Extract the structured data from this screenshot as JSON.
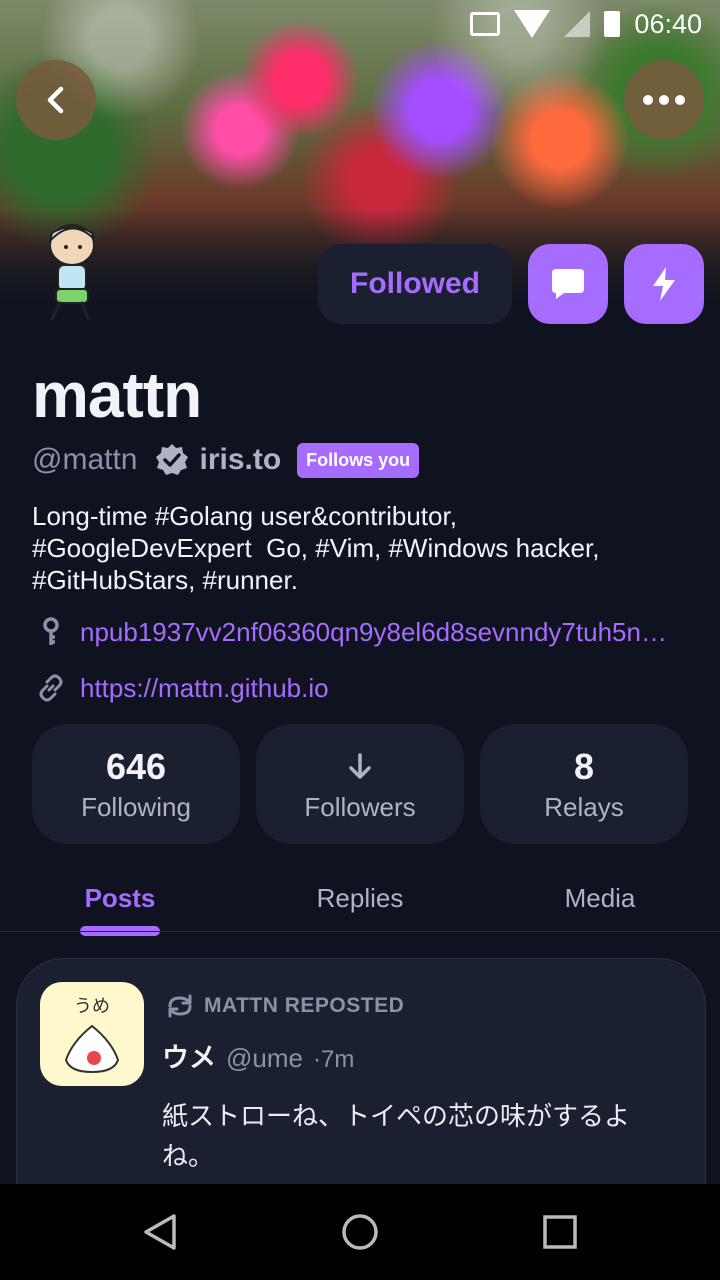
{
  "status_bar": {
    "time": "06:40"
  },
  "profile": {
    "display_name": "mattn",
    "handle": "@mattn",
    "nip05": "iris.to",
    "follows_you_badge": "Follows you",
    "bio_lines": [
      "Long-time #Golang user&contributor,",
      "#GoogleDevExpert  Go, #Vim, #Windows hacker,",
      "#GitHubStars, #runner."
    ],
    "npub": "npub1937vv2nf06360qn9y8el6d8sevnndy7tuh5n…",
    "website": "https://mattn.github.io"
  },
  "actions": {
    "follow_label": "Followed"
  },
  "stats": {
    "following": {
      "value": "646",
      "label": "Following"
    },
    "followers": {
      "label": "Followers"
    },
    "relays": {
      "value": "8",
      "label": "Relays"
    }
  },
  "tabs": [
    {
      "label": "Posts",
      "active": true
    },
    {
      "label": "Replies",
      "active": false
    },
    {
      "label": "Media",
      "active": false
    }
  ],
  "post": {
    "repost_label": "MATTN REPOSTED",
    "author": "ウメ",
    "handle": "@ume",
    "time": "·7m",
    "text": "紙ストローね、トイペの芯の味がするよね。",
    "avatar_text": "うめ"
  },
  "colors": {
    "accent": "#a66bff",
    "background": "#0f1320",
    "card": "#1b2030",
    "muted_text": "#8b92a8"
  },
  "icons": {
    "back": "chevron-left-icon",
    "more": "more-horizontal-icon",
    "message": "message-icon",
    "zap": "lightning-icon",
    "verified": "verified-badge-icon",
    "key": "key-icon",
    "link": "link-icon",
    "followers_loading": "arrow-down-icon",
    "repost": "repost-icon"
  }
}
